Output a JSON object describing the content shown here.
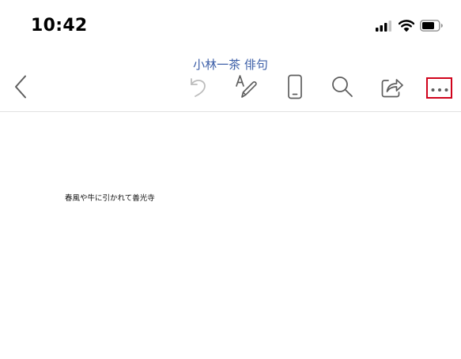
{
  "status_bar": {
    "time": "10:42",
    "icons": [
      "signal-icon",
      "wifi-icon",
      "battery-icon"
    ]
  },
  "toolbar": {
    "document_title": "小林一茶 俳句",
    "buttons": [
      "back-icon",
      "undo-icon",
      "draw-icon",
      "mobile-view-icon",
      "search-icon",
      "share-icon",
      "more-icon"
    ]
  },
  "document": {
    "text": "春風や牛に引かれて善光寺"
  },
  "colors": {
    "title": "#3d5fa8",
    "icon": "#5e5e5e",
    "highlight": "#d0021b"
  }
}
